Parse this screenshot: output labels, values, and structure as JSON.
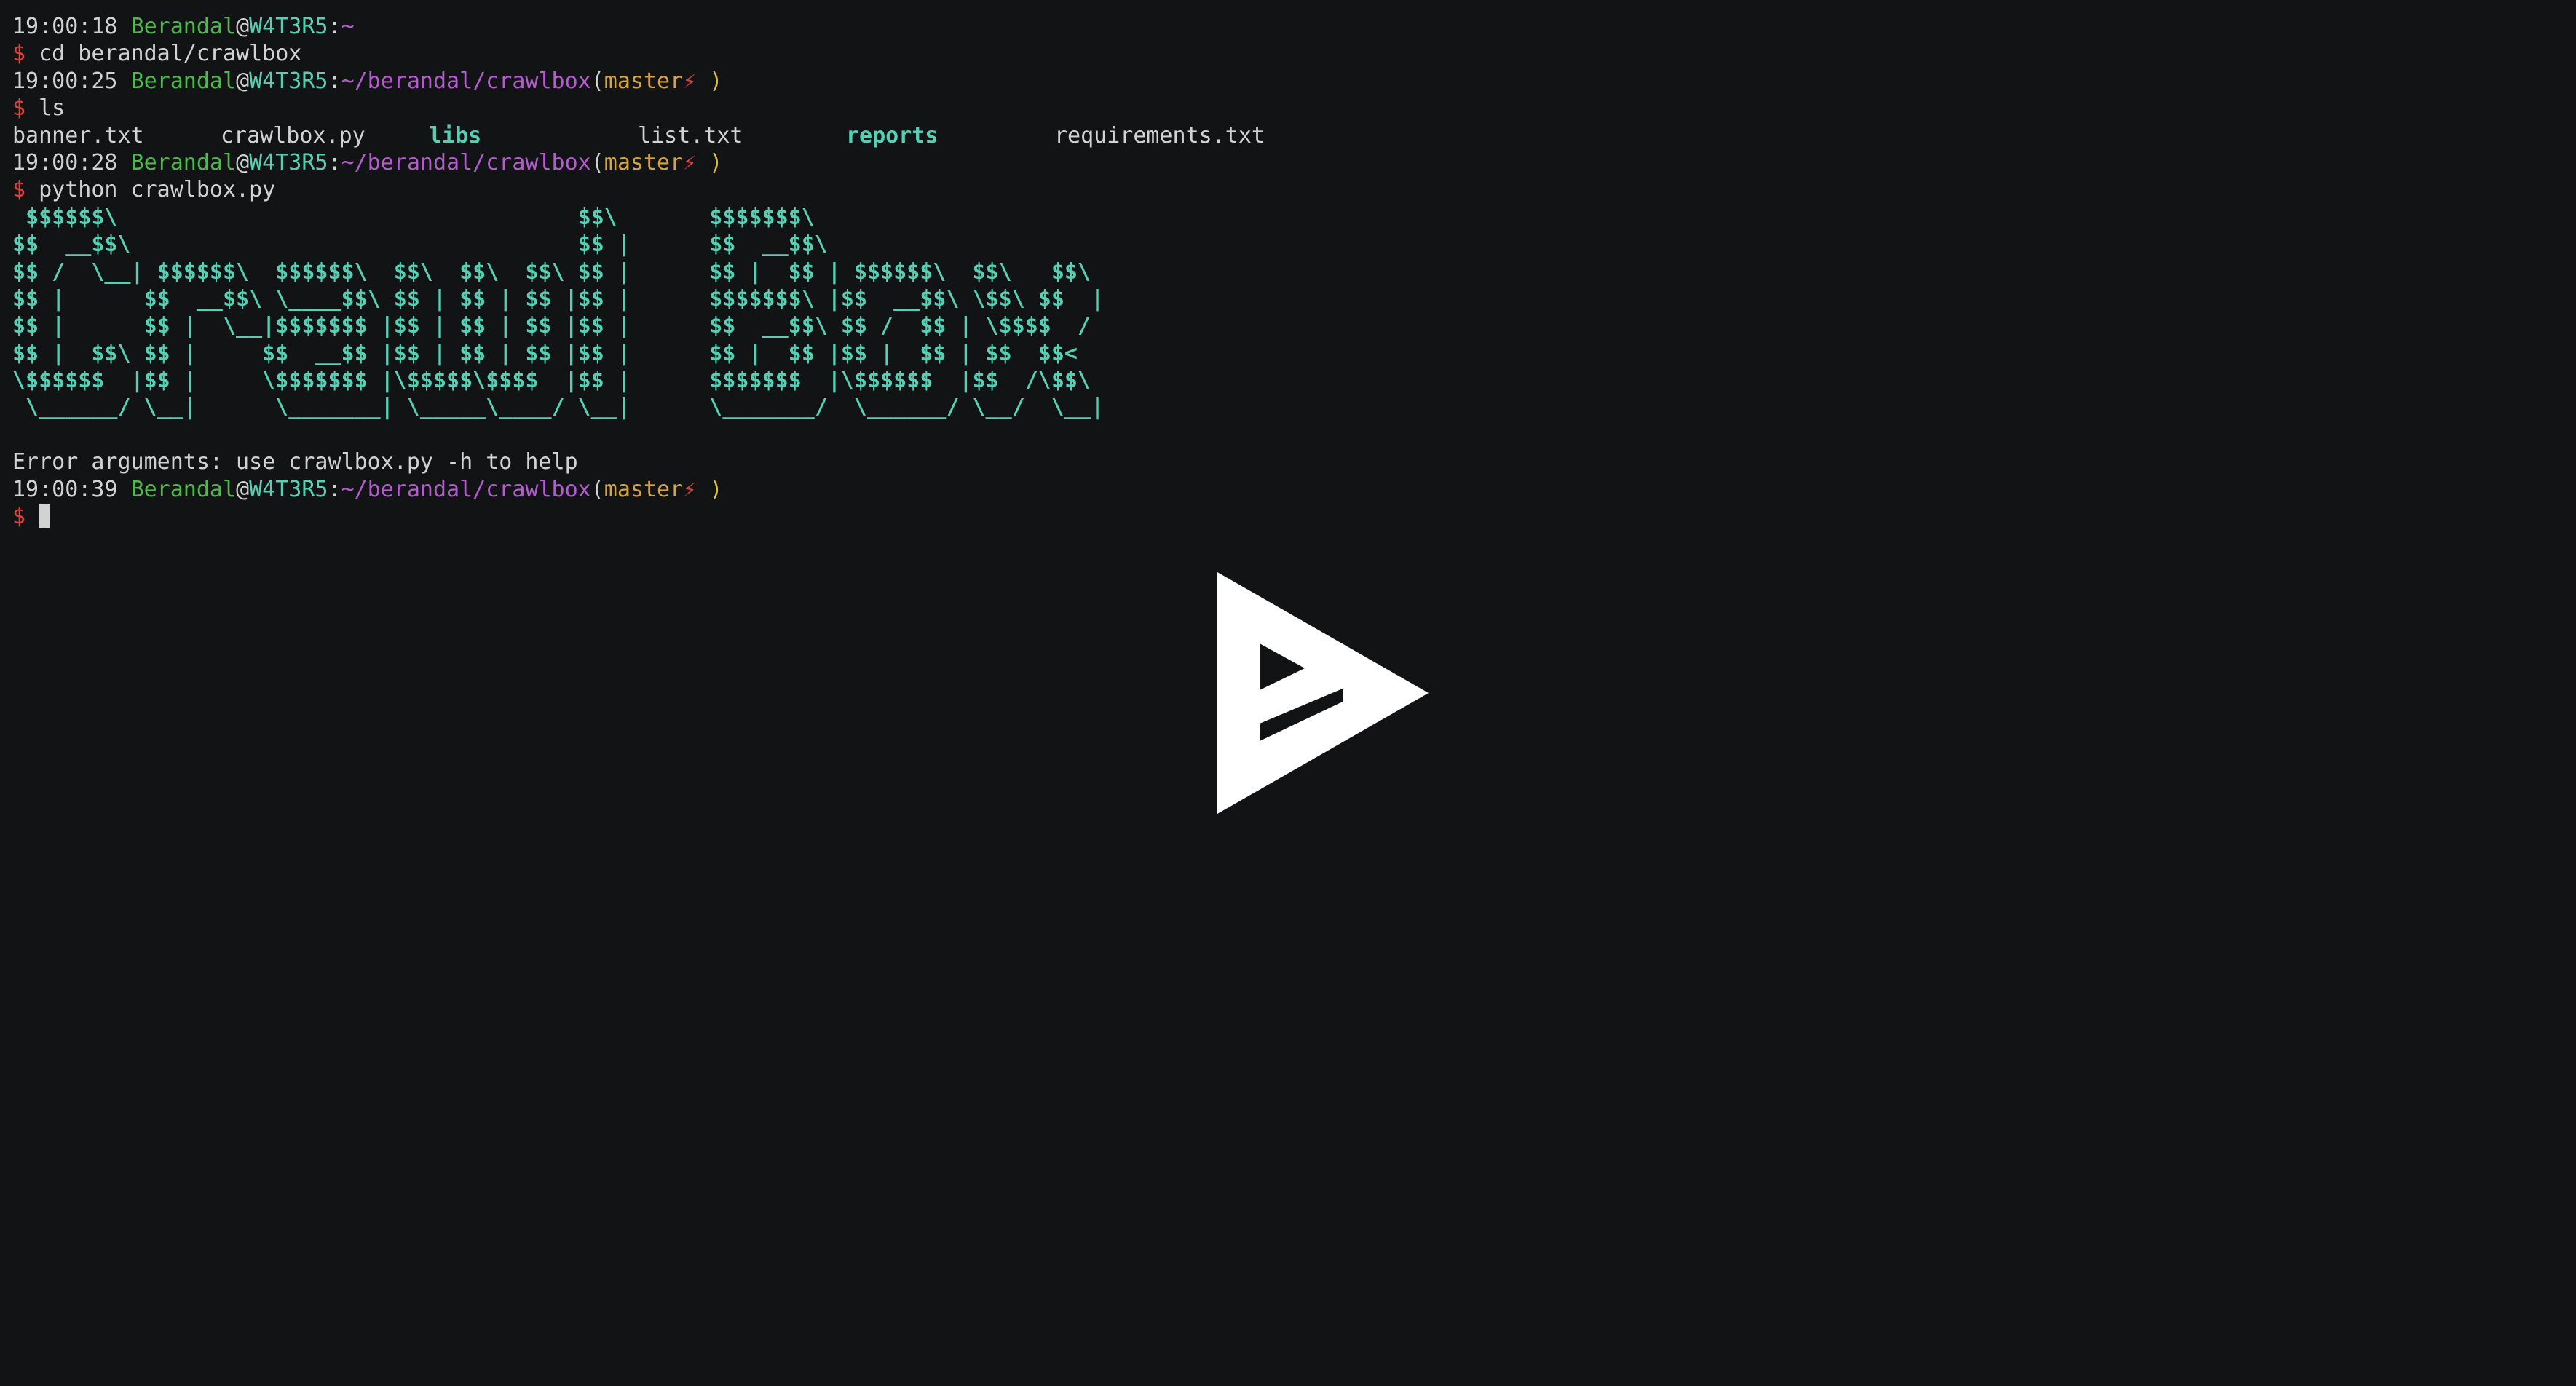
{
  "prompt_symbol": "$",
  "user": "Berandal",
  "at": "@",
  "host": "W4T3R5",
  "colon": ":",
  "git_open": "(",
  "git_bolt": "⚡",
  "git_close": " )",
  "lines": {
    "l1": {
      "time": "19:00:18",
      "path": "~"
    },
    "l2": {
      "cmd": "cd berandal/crawlbox"
    },
    "l3": {
      "time": "19:00:25",
      "path": "~/berandal/crawlbox",
      "branch": "master"
    },
    "l4": {
      "cmd": "ls"
    },
    "l6": {
      "time": "19:00:28",
      "path": "~/berandal/crawlbox",
      "branch": "master"
    },
    "l7": {
      "cmd": "python crawlbox.py"
    },
    "l17": {
      "time": "19:00:39",
      "path": "~/berandal/crawlbox",
      "branch": "master"
    }
  },
  "ls_output": [
    {
      "name": "banner.txt",
      "type": "file"
    },
    {
      "name": "crawlbox.py",
      "type": "file"
    },
    {
      "name": "libs",
      "type": "dir"
    },
    {
      "name": "list.txt",
      "type": "file"
    },
    {
      "name": "reports",
      "type": "dir"
    },
    {
      "name": "requirements.txt",
      "type": "file"
    }
  ],
  "banner": [
    " $$$$$$\\                                   $$\\       $$$$$$$\\",
    "$$  __$$\\                                  $$ |      $$  __$$\\",
    "$$ /  \\__| $$$$$$\\  $$$$$$\\  $$\\  $$\\  $$\\ $$ |      $$ |  $$ | $$$$$$\\  $$\\   $$\\",
    "$$ |      $$  __$$\\ \\____$$\\ $$ | $$ | $$ |$$ |      $$$$$$$\\ |$$  __$$\\ \\$$\\ $$  |",
    "$$ |      $$ |  \\__|$$$$$$$ |$$ | $$ | $$ |$$ |      $$  __$$\\ $$ /  $$ | \\$$$$  /",
    "$$ |  $$\\ $$ |     $$  __$$ |$$ | $$ | $$ |$$ |      $$ |  $$ |$$ |  $$ | $$  $$<",
    "\\$$$$$$  |$$ |     \\$$$$$$$ |\\$$$$$\\$$$$  |$$ |      $$$$$$$  |\\$$$$$$  |$$  /\\$$\\",
    " \\______/ \\__|      \\_______| \\_____\\____/ \\__|      \\_______/  \\______/ \\__/  \\__|"
  ],
  "error_message": "Error arguments: use crawlbox.py -h to help",
  "colors": {
    "background": "#121314",
    "text": "#d2d2d2",
    "user": "#4fb84f",
    "host": "#56d0b4",
    "path": "#b45bcf",
    "branch": "#d8a43c",
    "prompt": "#d6453d",
    "directory": "#56d0b4",
    "banner": "#56d0b4"
  },
  "overlay": {
    "icon": "asciinema-play-icon"
  }
}
